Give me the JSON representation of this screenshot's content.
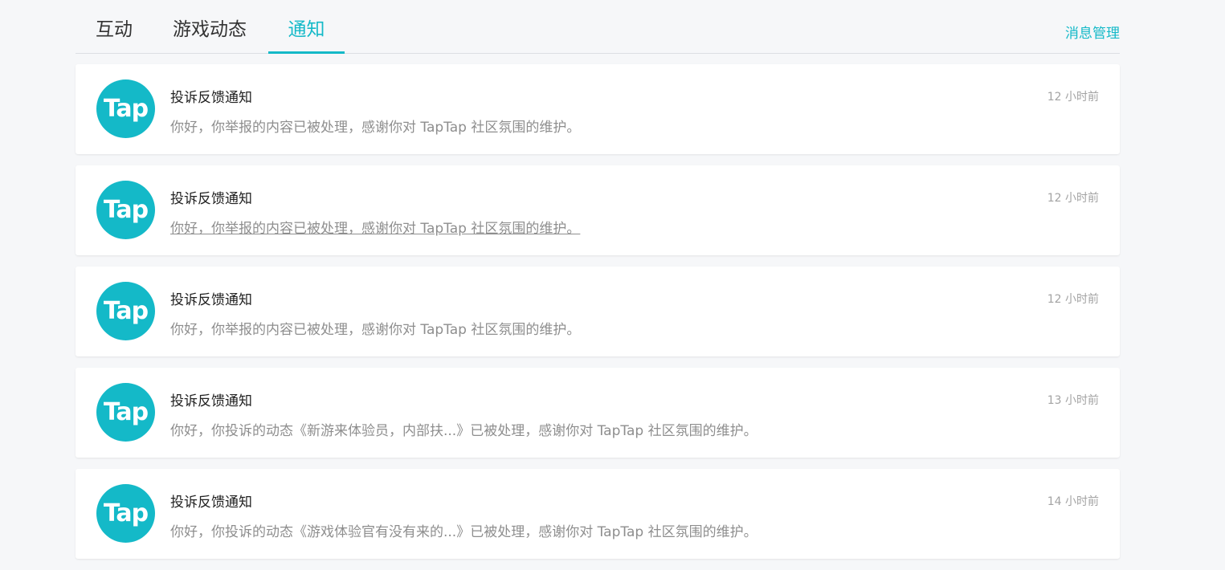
{
  "tabs": [
    {
      "label": "互动"
    },
    {
      "label": "游戏动态"
    },
    {
      "label": "通知"
    }
  ],
  "manage_label": "消息管理",
  "avatar_text": "Tap",
  "colors": {
    "accent": "#14b9c8",
    "title": "#222222",
    "body": "#8e8e8e",
    "time": "#a3a3a3",
    "background": "#f6f7f9"
  },
  "notifications": [
    {
      "title": "投诉反馈通知",
      "body": "你好，你举报的内容已被处理，感谢你对 TapTap 社区氛围的维护。",
      "time": "12 小时前"
    },
    {
      "title": "投诉反馈通知",
      "body": "你好，你举报的内容已被处理，感谢你对 TapTap 社区氛围的维护。",
      "time": "12 小时前"
    },
    {
      "title": "投诉反馈通知",
      "body": "你好，你举报的内容已被处理，感谢你对 TapTap 社区氛围的维护。",
      "time": "12 小时前"
    },
    {
      "title": "投诉反馈通知",
      "body": "你好，你投诉的动态《新游来体验员，内部扶...》已被处理，感谢你对 TapTap 社区氛围的维护。",
      "time": "13 小时前"
    },
    {
      "title": "投诉反馈通知",
      "body": "你好，你投诉的动态《游戏体验官有没有来的...》已被处理，感谢你对 TapTap 社区氛围的维护。",
      "time": "14 小时前"
    }
  ]
}
